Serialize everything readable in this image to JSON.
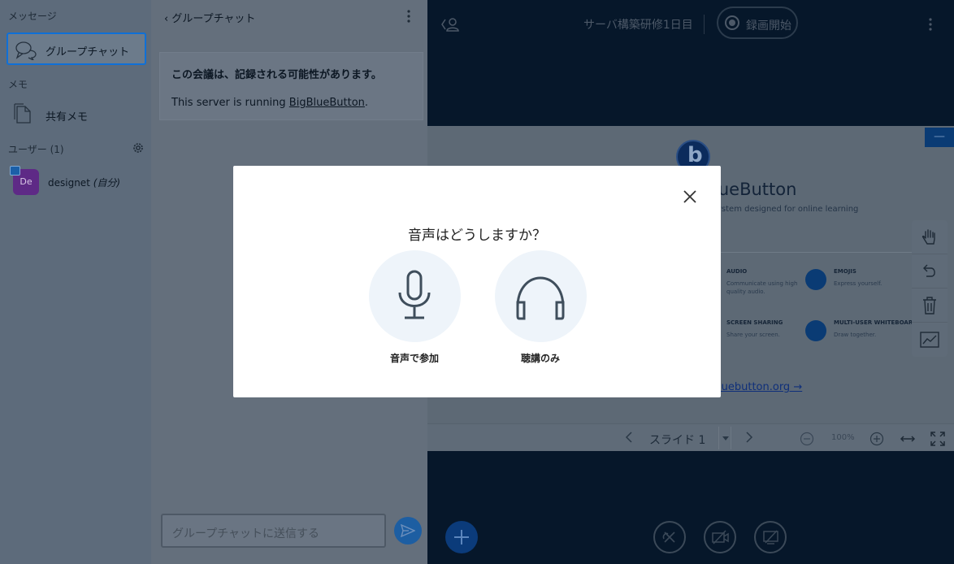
{
  "sidebar": {
    "messages_title": "メッセージ",
    "group_chat_label": "グループチャット",
    "notes_title": "メモ",
    "shared_notes_label": "共有メモ",
    "users_title": "ユーザー (1)",
    "user": {
      "avatar_initials": "De",
      "name": "designet",
      "self_tag": "(自分)"
    }
  },
  "chat": {
    "header_title": "グループチャット",
    "welcome_line1": "この会議は、記録される可能性があります。",
    "welcome_line2_prefix": "This server is running ",
    "welcome_link": "BigBlueButton",
    "welcome_line2_suffix": ".",
    "input_placeholder": "グループチャットに送信する"
  },
  "main": {
    "meeting_title": "サーバ構築研修1日目",
    "record_label": "録画開始",
    "slide": {
      "brand_partial": "lueButton",
      "tagline_partial": "ystem designed for online learning",
      "features": [
        {
          "title": "AUDIO",
          "desc": "Communicate using high quality audio."
        },
        {
          "title": "EMOJIS",
          "desc": "Express yourself."
        },
        {
          "title": "SCREEN SHARING",
          "desc": "Share your screen."
        },
        {
          "title": "MULTI-USER WHITEBOARD",
          "desc": "Draw together."
        }
      ],
      "link_partial": "luebutton.org →",
      "minimize_label": "—"
    },
    "slide_nav": {
      "slide_label": "スライド 1",
      "zoom_level": "100%"
    }
  },
  "modal": {
    "title": "音声はどうしますか？",
    "microphone_label": "音声で参加",
    "listen_only_label": "聴講のみ"
  },
  "colors": {
    "accent": "#0f70d7",
    "modal_circle": "#eef4fa",
    "icon_stroke": "#3f4e5c"
  }
}
